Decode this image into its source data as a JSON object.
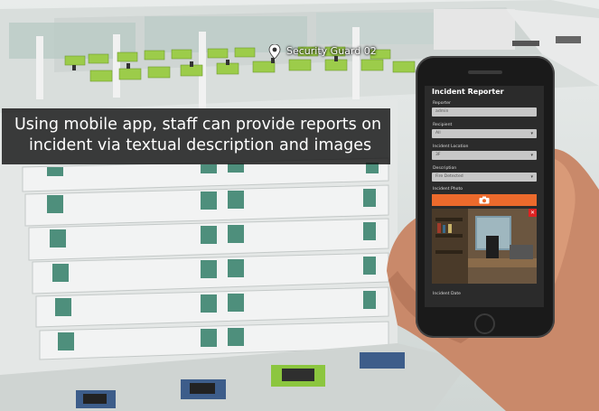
{
  "overlay": {
    "caption_line1": "Using mobile app, staff can provide reports on",
    "caption_line2": "incident via textual description and images"
  },
  "map_marker": {
    "label": "Security Guard 02",
    "icon": "location-pin-icon"
  },
  "app": {
    "title": "Incident Reporter",
    "reporter_label": "Reporter",
    "reporter_value": "admin",
    "recipient_label": "Recipient",
    "recipient_value": "All",
    "location_label": "Incident Location",
    "location_value": "3F",
    "description_label": "Description",
    "description_value": "Fire Detected",
    "photo_label": "Incident Photo",
    "photo_icon": "camera-icon",
    "date_label": "Incident Date"
  },
  "colors": {
    "accent": "#ec6a2c",
    "desk_green": "#9ccc4a",
    "app_bg": "#2b2b2b"
  }
}
